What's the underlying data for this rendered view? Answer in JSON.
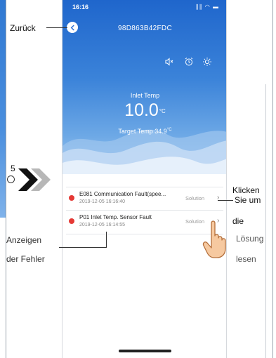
{
  "status_bar": {
    "time": "16:16",
    "indicators": "∥∥ ◠ ▬"
  },
  "header": {
    "device_id": "98D863B42FDC",
    "back_icon": "back-arrow-icon"
  },
  "controls": [
    "mute-icon",
    "alarm-clock-icon",
    "sun-icon"
  ],
  "temperature": {
    "inlet_label": "Inlet Temp",
    "inlet_value": "10.0",
    "inlet_unit": "°C",
    "target_label": "Target Temp",
    "target_value": "34.9",
    "target_unit": "°C"
  },
  "faults": [
    {
      "title": "E081 Communication Fault(spee...",
      "time": "2019-12-05 16:16:40",
      "action": "Solution"
    },
    {
      "title": "P01 Inlet Temp. Sensor Fault",
      "time": "2019-12-05 16:14:55",
      "action": "Solution"
    }
  ],
  "annotations": {
    "step": "5",
    "back": "Zurück",
    "click_1": "Klicken",
    "click_2": "Sie um",
    "click_3": "die",
    "click_4": "Lösung",
    "click_5": "lesen",
    "show_1": "Anzeigen",
    "show_2": "der Fehler"
  },
  "colors": {
    "hero_top": "#1f66cc",
    "hero_bottom": "#a9cdf2",
    "fault_dot": "#e53935"
  }
}
